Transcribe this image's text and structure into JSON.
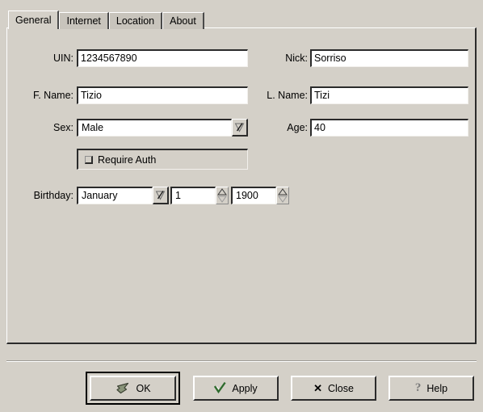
{
  "tabs": [
    {
      "label": "General",
      "active": true
    },
    {
      "label": "Internet",
      "active": false
    },
    {
      "label": "Location",
      "active": false
    },
    {
      "label": "About",
      "active": false
    }
  ],
  "form": {
    "uin": {
      "label": "UIN:",
      "value": "1234567890"
    },
    "nick": {
      "label": "Nick:",
      "value": "Sorriso"
    },
    "first_name": {
      "label": "F. Name:",
      "value": "Tizio"
    },
    "last_name": {
      "label": "L. Name:",
      "value": "Tizi"
    },
    "sex": {
      "label": "Sex:",
      "value": "Male"
    },
    "age": {
      "label": "Age:",
      "value": "40"
    },
    "require_auth": {
      "label": "Require Auth",
      "checked": false
    },
    "birthday": {
      "label": "Birthday:",
      "month": "January",
      "day": "1",
      "year": "1900"
    }
  },
  "buttons": {
    "ok": {
      "label": "OK",
      "icon": "pointer-arrow-icon",
      "default": true
    },
    "apply": {
      "label": "Apply",
      "icon": "check-icon"
    },
    "close": {
      "label": "Close",
      "icon": "x-icon"
    },
    "help": {
      "label": "Help",
      "icon": "question-mark-icon"
    }
  },
  "colors": {
    "background": "#d4d0c8",
    "field_background": "#ffffff",
    "shadow": "#2b2b2b",
    "highlight": "#ffffff",
    "apply_check": "#2d6b2d",
    "ok_icon": "#8a957a"
  }
}
